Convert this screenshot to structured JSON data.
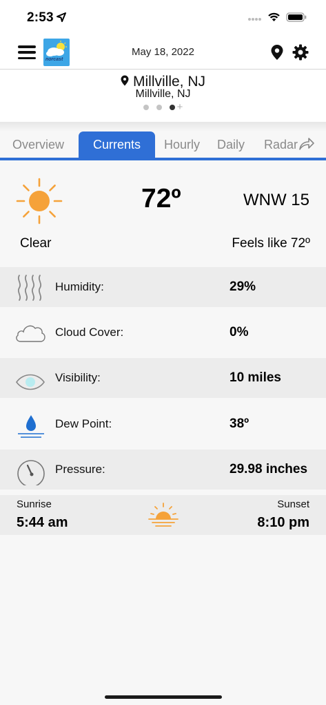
{
  "status_bar": {
    "time": "2:53"
  },
  "header": {
    "date": "May 18, 2022",
    "logo_text": "norcast"
  },
  "location": {
    "name": "Millville, NJ",
    "subtitle": "Millville, NJ"
  },
  "tabs": [
    {
      "label": "Overview",
      "active": false
    },
    {
      "label": "Currents",
      "active": true
    },
    {
      "label": "Hourly",
      "active": false
    },
    {
      "label": "Daily",
      "active": false
    },
    {
      "label": "Radar",
      "active": false
    }
  ],
  "current": {
    "temperature": "72º",
    "wind": "WNW 15",
    "condition": "Clear",
    "feels_like": "Feels like 72º"
  },
  "details": [
    {
      "label": "Humidity:",
      "value": "29%",
      "icon": "humidity-icon"
    },
    {
      "label": "Cloud Cover:",
      "value": "0%",
      "icon": "cloud-icon"
    },
    {
      "label": "Visibility:",
      "value": "10 miles",
      "icon": "eye-icon"
    },
    {
      "label": "Dew Point:",
      "value": "38º",
      "icon": "dew-drop-icon"
    },
    {
      "label": "Pressure:",
      "value": "29.98 inches",
      "icon": "gauge-icon"
    }
  ],
  "sun": {
    "sunrise_label": "Sunrise",
    "sunrise_time": "5:44 am",
    "sunset_label": "Sunset",
    "sunset_time": "8:10 pm"
  },
  "colors": {
    "accent": "#2f6fd6",
    "sun": "#f5a23a",
    "logo_bg": "#3da6e6"
  }
}
